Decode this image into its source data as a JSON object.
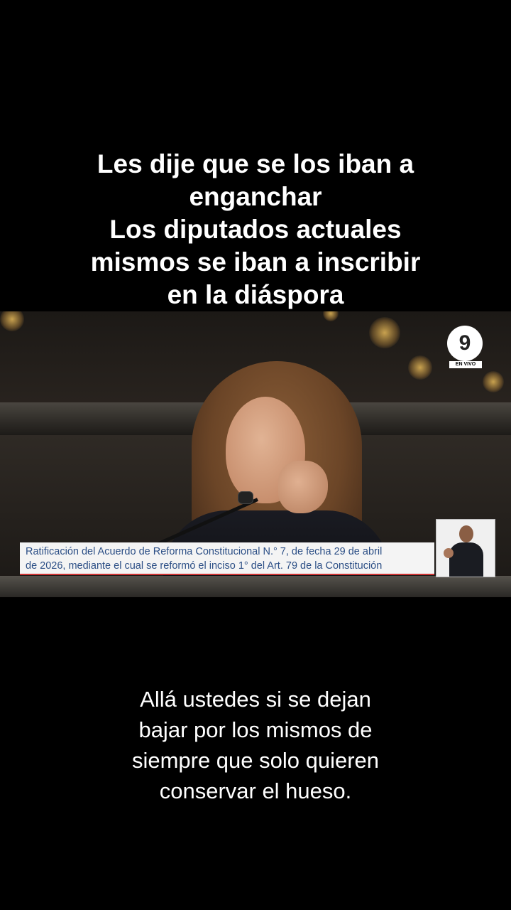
{
  "caption_top": [
    "Les dije que se los iban a",
    "enganchar",
    "Los diputados actuales",
    "mismos se iban a inscribir",
    "en la diáspora"
  ],
  "channel": {
    "logo_text": "9",
    "live_label": "EN VIVO"
  },
  "lower_third": [
    "Ratificación del Acuerdo de Reforma Constitucional N.° 7, de fecha 29 de abril",
    "de 2026, mediante el cual se reformó el inciso 1° del Art. 79 de la Constitución"
  ],
  "caption_bottom": [
    "Allá ustedes si se dejan",
    "bajar por los mismos de",
    "siempre que solo quieren",
    "conservar el hueso."
  ]
}
